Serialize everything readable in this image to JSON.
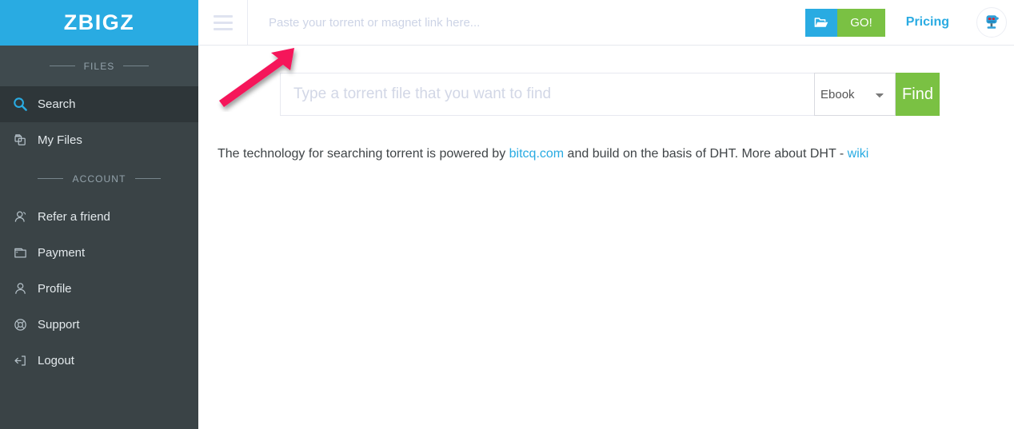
{
  "brand": {
    "name": "ZBIGZ",
    "color": "#29abe2"
  },
  "sidebar": {
    "background": "#3a4346",
    "sections": [
      {
        "label": "FILES"
      },
      {
        "label": "ACCOUNT"
      }
    ],
    "files_items": [
      {
        "label": "Search",
        "icon": "search-icon",
        "active": true
      },
      {
        "label": "My Files",
        "icon": "files-icon",
        "active": false
      }
    ],
    "account_items": [
      {
        "label": "Refer a friend",
        "icon": "user-add-icon"
      },
      {
        "label": "Payment",
        "icon": "wallet-icon"
      },
      {
        "label": "Profile",
        "icon": "user-icon"
      },
      {
        "label": "Support",
        "icon": "lifebuoy-icon"
      },
      {
        "label": "Logout",
        "icon": "logout-icon"
      }
    ]
  },
  "header": {
    "menu_icon": "hamburger-icon",
    "magnet": {
      "placeholder": "Paste your torrent or magnet link here...",
      "value": ""
    },
    "folder_icon": "folder-open-icon",
    "go_label": "GO!",
    "go_color": "#7ac143",
    "folder_color": "#29abe2",
    "pricing_label": "Pricing",
    "pricing_color": "#29abe2",
    "avatar_icon": "robot-avatar-icon"
  },
  "main": {
    "search": {
      "placeholder": "Type a torrent file that you want to find",
      "value": "",
      "selected_type": "Ebook",
      "type_options": [
        "Ebook"
      ],
      "find_label": "Find",
      "find_color": "#7ac143"
    },
    "info": {
      "part1": "The technology for searching torrent is powered by ",
      "link1": "bitcq.com",
      "part2": " and build on the basis of DHT. More about DHT - ",
      "link2": "wiki"
    }
  },
  "annotation": {
    "arrow": {
      "color": "#f5125a",
      "points_to": "search-input"
    }
  }
}
